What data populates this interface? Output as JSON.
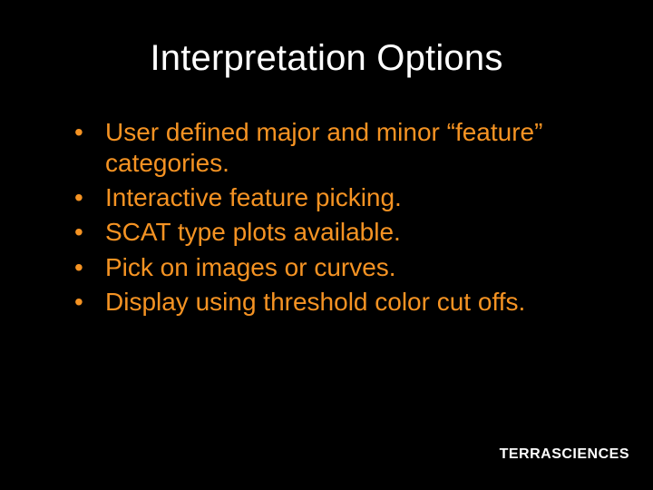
{
  "title": "Interpretation Options",
  "bullets": [
    "User defined major and minor “feature” categories.",
    "Interactive feature picking.",
    "SCAT type plots available.",
    "Pick on images or curves.",
    "Display using threshold color cut offs."
  ],
  "footer": {
    "company": "TERRASCIENCES"
  }
}
